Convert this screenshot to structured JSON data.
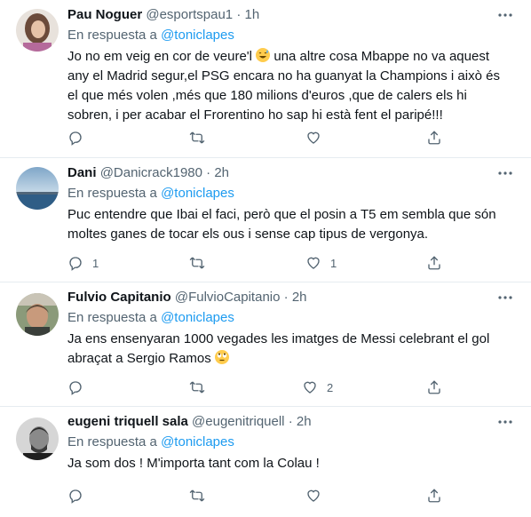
{
  "reply_prefix": "En respuesta a",
  "tweets": [
    {
      "name": "Pau Noguer",
      "handle": "@esportspau1",
      "dot": "·",
      "time": "1h",
      "reply_to": "@toniclapes",
      "text_before_emoji": "Jo no em veig en cor de veure'l ",
      "emoji": "sweat-smile-emoji",
      "text_after_emoji": " una altre cosa Mbappe no va aquest any el Madrid segur,el PSG encara no ha guanyat la Champions i això és el que més volen ,més que 180 milions d'euros ,que de calers els hi sobren, i per acabar el Frorentino ho sap hi està fent el paripé!!!",
      "reply_count": "",
      "retweet_count": "",
      "like_count": ""
    },
    {
      "name": "Dani",
      "handle": "@Danicrack1980",
      "dot": "·",
      "time": "2h",
      "reply_to": "@toniclapes",
      "text": "Puc entendre que Ibai el faci, però que el posin a T5 em sembla que són moltes ganes de tocar els ous i sense cap tipus de vergonya.",
      "reply_count": "1",
      "retweet_count": "",
      "like_count": "1"
    },
    {
      "name": "Fulvio Capitanio",
      "handle": "@FulvioCapitanio",
      "dot": "·",
      "time": "2h",
      "reply_to": "@toniclapes",
      "text_before_emoji": "Ja ens ensenyaran 1000 vegades les imatges de Messi celebrant el gol abraçat a Sergio Ramos ",
      "emoji": "rolling-eyes-emoji",
      "reply_count": "",
      "retweet_count": "",
      "like_count": "2"
    },
    {
      "name": "eugeni triquell sala",
      "handle": "@eugenitriquell",
      "dot": "·",
      "time": "2h",
      "reply_to": "@toniclapes",
      "text": "Ja som dos ! M'importa tant com la Colau !",
      "reply_count": "",
      "retweet_count": "",
      "like_count": ""
    }
  ],
  "colors": {
    "link": "#1d9bf0",
    "secondary": "#536471",
    "divider": "#e6ecf0"
  }
}
